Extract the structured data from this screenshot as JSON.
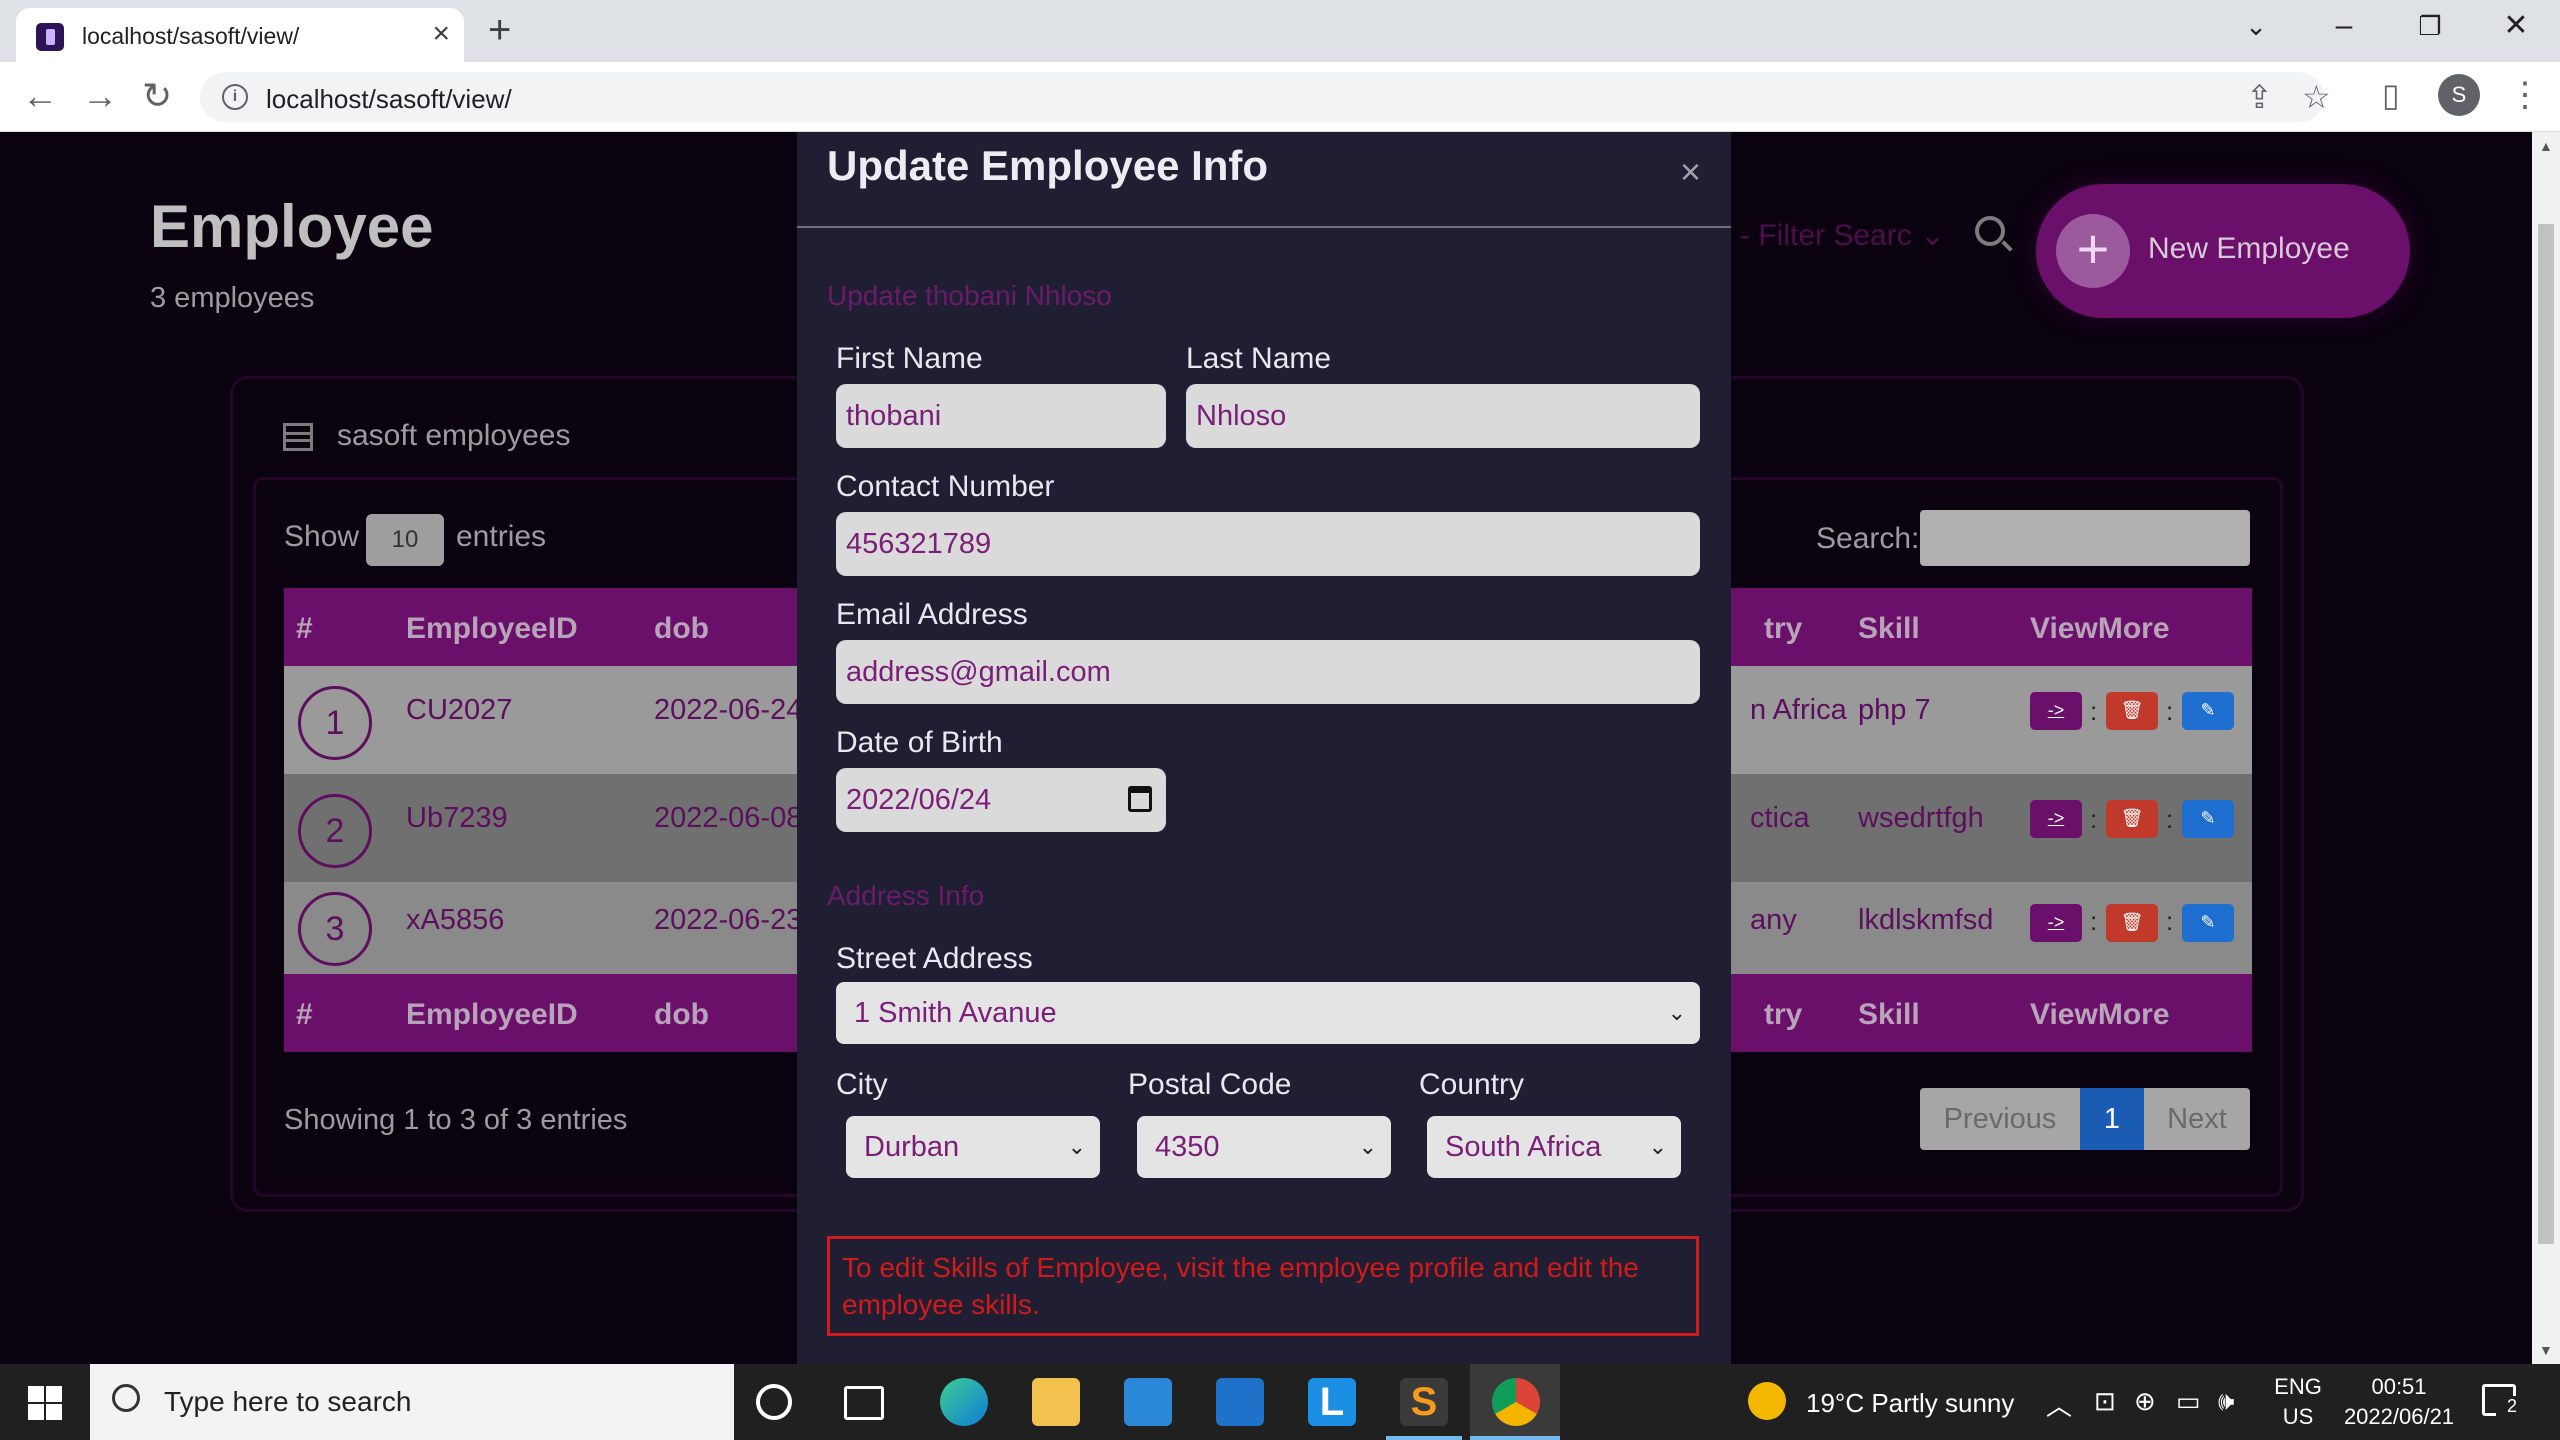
{
  "browser": {
    "tab_title": "localhost/sasoft/view/",
    "url": "localhost/sasoft/view/"
  },
  "page": {
    "title": "Employee",
    "subtitle": "3 employees",
    "filter_placeholder": "- Filter Searc",
    "new_button": "New Employee",
    "card_title": "sasoft employees",
    "show_label": "Show",
    "show_value": "10",
    "entries_label": "entries",
    "search_label": "Search:",
    "columns": [
      "#",
      "EmployeeID",
      "dob",
      "try",
      "Skill",
      "ViewMore"
    ],
    "rows": [
      {
        "num": "1",
        "id": "CU2027",
        "dob": "2022-06-24",
        "country": "n Africa",
        "skill": "php 7"
      },
      {
        "num": "2",
        "id": "Ub7239",
        "dob": "2022-06-08",
        "country": "ctica",
        "skill": "wsedrtfgh"
      },
      {
        "num": "3",
        "id": "xA5856",
        "dob": "2022-06-23",
        "country": "any",
        "skill": "lkdlskmfsd"
      }
    ],
    "action_view": "->",
    "action_sep": ":",
    "showing_text": "Showing 1 to 3 of 3 entries",
    "pager": {
      "previous": "Previous",
      "current": "1",
      "next": "Next"
    }
  },
  "modal": {
    "title": "Update Employee Info",
    "close": "×",
    "section_update": "Update thobani Nhloso",
    "first_name_label": "First Name",
    "first_name_value": "thobani",
    "last_name_label": "Last Name",
    "last_name_value": "Nhloso",
    "contact_label": "Contact Number",
    "contact_value": "456321789",
    "email_label": "Email Address",
    "email_value": "address@gmail.com",
    "dob_label": "Date of Birth",
    "dob_value": "2022/06/24",
    "section_address": "Address Info",
    "street_label": "Street Address",
    "street_value": "1 Smith Avanue",
    "city_label": "City",
    "city_value": "Durban",
    "postal_label": "Postal Code",
    "postal_value": "4350",
    "country_label": "Country",
    "country_value": "South Africa",
    "notice": "To edit Skills of Employee, visit the employee profile and edit the employee skills."
  },
  "taskbar": {
    "search_placeholder": "Type here to search",
    "weather": "19°C  Partly sunny",
    "lang_top": "ENG",
    "lang_bottom": "US",
    "time": "00:51",
    "date": "2022/06/21",
    "notification_count": "2"
  },
  "colors": {
    "accent": "#6a0f6a",
    "modal_bg": "#201e33",
    "notice": "#d11a1a"
  }
}
